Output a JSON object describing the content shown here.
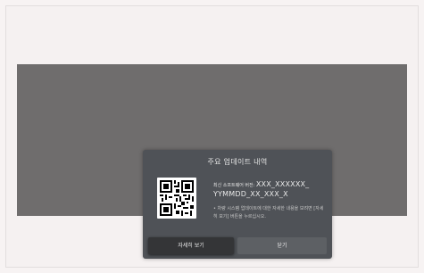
{
  "popup": {
    "title": "주요 업데이트 내역",
    "version_prefix": "최신 소프트웨어 버전:",
    "version_part1": "XXX_XXXXXX_",
    "version_part2": "YYMMDD_XX_XXX_X",
    "note": "• 차량 시스템 업데이트에 대한 자세한 내용을 보려면 [자세히 보기] 버튼을 누르십시오.",
    "detail_button": "자세히 보기",
    "close_button": "닫기"
  },
  "icons": {
    "qr": "qr-code-icon"
  },
  "colors": {
    "background": "#f5f1f1",
    "dim_overlay": "#6f6d6d",
    "popup_bg": "#4f5257",
    "button_active": "#343537",
    "button_normal": "#5d6064"
  }
}
